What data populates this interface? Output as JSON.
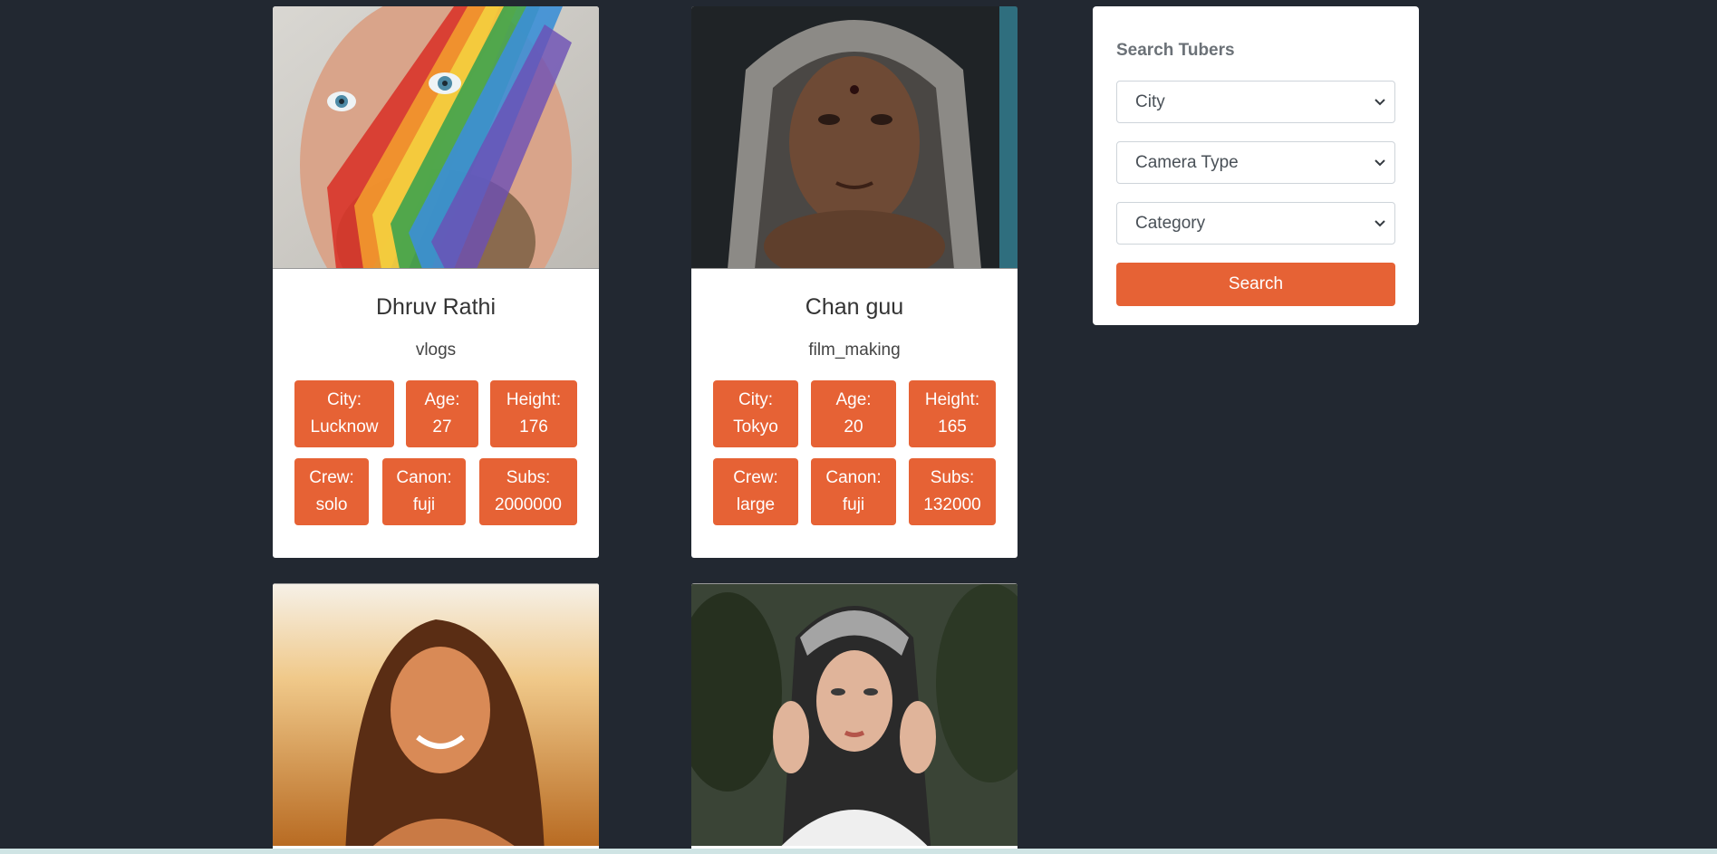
{
  "tubers": [
    {
      "name": "Dhruv Rathi",
      "category": "vlogs",
      "tags_row1": [
        {
          "label": "City:",
          "value": "Lucknow"
        },
        {
          "label": "Age:",
          "value": "27"
        },
        {
          "label": "Height:",
          "value": "176"
        }
      ],
      "tags_row2": [
        {
          "label": "Crew:",
          "value": "solo"
        },
        {
          "label": "Canon:",
          "value": "fuji"
        },
        {
          "label": "Subs:",
          "value": "2000000"
        }
      ]
    },
    {
      "name": "Chan guu",
      "category": "film_making",
      "tags_row1": [
        {
          "label": "City:",
          "value": "Tokyo"
        },
        {
          "label": "Age:",
          "value": "20"
        },
        {
          "label": "Height:",
          "value": "165"
        }
      ],
      "tags_row2": [
        {
          "label": "Crew:",
          "value": "large"
        },
        {
          "label": "Canon:",
          "value": "fuji"
        },
        {
          "label": "Subs:",
          "value": "132000"
        }
      ]
    }
  ],
  "search": {
    "title": "Search Tubers",
    "city_placeholder": "City",
    "camera_placeholder": "Camera Type",
    "category_placeholder": "Category",
    "button_label": "Search"
  },
  "colors": {
    "background": "#222831",
    "accent": "#e66235",
    "card": "#ffffff"
  }
}
